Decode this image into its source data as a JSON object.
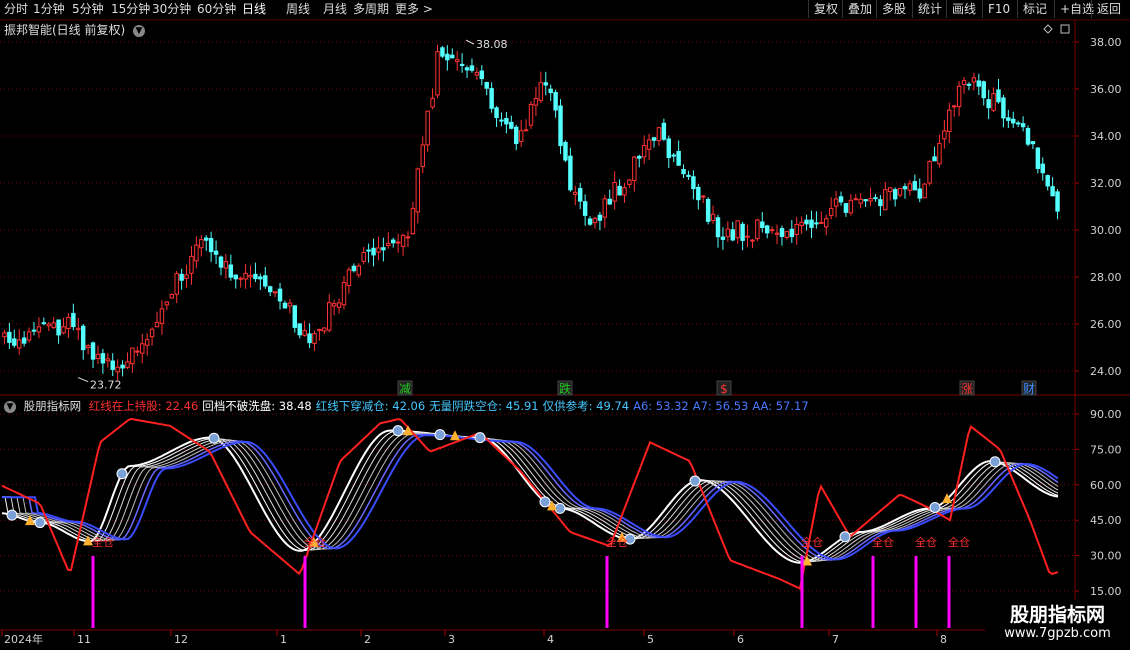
{
  "toolbar": {
    "periods": [
      "分时",
      "1分钟",
      "5分钟",
      "15分钟",
      "30分钟",
      "60分钟",
      "日线",
      "周线",
      "月线",
      "多周期",
      "更多 >"
    ],
    "active_period": "日线",
    "right_buttons": [
      "复权",
      "叠加",
      "多股",
      "统计",
      "画线",
      "F10",
      "标记",
      "+自选",
      "返回"
    ]
  },
  "main_chart": {
    "title": "振邦智能(日线 前复权)",
    "high_label": "38.08",
    "low_label": "23.72",
    "y_ticks": [
      "38.00",
      "36.00",
      "34.00",
      "32.00",
      "30.00",
      "28.00",
      "26.00",
      "24.00"
    ],
    "markers": [
      {
        "text": "减",
        "color": "#22cc22"
      },
      {
        "text": "跌",
        "color": "#22cc22"
      },
      {
        "text": "$",
        "color": "#ff3333"
      },
      {
        "text": "涨",
        "color": "#ff3333"
      },
      {
        "text": "财",
        "color": "#3a8cff"
      }
    ]
  },
  "indicator": {
    "name": "股朋指标网",
    "legend": [
      {
        "label": "红线在上持股:",
        "value": "22.46",
        "color": "#ff3030"
      },
      {
        "label": "回档不破洗盘:",
        "value": "38.48",
        "color": "#ffffff"
      },
      {
        "label": "红线下穿减仓:",
        "value": "42.06",
        "color": "#46c8ff"
      },
      {
        "label": "无量阴跌空仓:",
        "value": "45.91",
        "color": "#46c8ff"
      },
      {
        "label": "仅供参考:",
        "value": "49.74",
        "color": "#46c8ff"
      },
      {
        "label": "A6:",
        "value": "53.32",
        "color": "#4a78ff"
      },
      {
        "label": "A7:",
        "value": "56.53",
        "color": "#4a78ff"
      },
      {
        "label": "AA:",
        "value": "57.17",
        "color": "#4a78ff"
      }
    ],
    "y_ticks": [
      "90.00",
      "75.00",
      "60.00",
      "45.00",
      "30.00",
      "15.00"
    ],
    "signal_label": "全仓"
  },
  "x_axis": {
    "labels": [
      "2024年",
      "11",
      "12",
      "1",
      "2",
      "3",
      "4",
      "5",
      "6",
      "7",
      "8"
    ]
  },
  "watermark": {
    "line1": "股朋指标网",
    "line2": "www.7gpzb.com"
  },
  "colors": {
    "up": "#ff3333",
    "down": "#54ffff",
    "ma_white": "#ffffff",
    "ma_blue": "#3a4cff",
    "signal_bar": "#ff00ff",
    "grid": "#7a0000"
  }
}
